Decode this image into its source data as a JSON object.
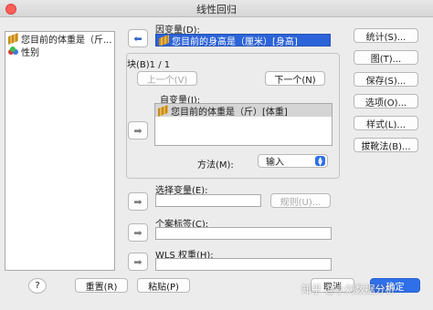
{
  "window": {
    "title": "线性回归"
  },
  "variables": [
    {
      "icon": "ruler-icon",
      "label": "您目前的体重是（斤..."
    },
    {
      "icon": "nominal-icon",
      "label": "性别"
    }
  ],
  "dependent": {
    "label": "因变量(D):",
    "value": "您目前的身高是（厘米）[身高]"
  },
  "block": {
    "label": "块(B)1 / 1",
    "prev_label": "上一个(V)",
    "next_label": "下一个(N)",
    "independent_label": "自变量(I):",
    "independent_items": [
      "您目前的体重是（斤）[体重]"
    ],
    "method_label": "方法(M):",
    "method_value": "输入"
  },
  "selection": {
    "label": "选择变量(E):",
    "rule_label": "规则(U)..."
  },
  "case_labels": {
    "label": "个案标签(C):"
  },
  "wls": {
    "label": "WLS 权重(H):"
  },
  "side_buttons": [
    "统计(S)...",
    "图(T)...",
    "保存(S)...",
    "选项(O)...",
    "样式(L)...",
    "拔靴法(B)..."
  ],
  "footer": {
    "help": "?",
    "reset": "重置(R)",
    "paste": "粘贴(P)",
    "cancel": "取消",
    "ok": "确定"
  },
  "watermark": "知乎 @小刘数据分析",
  "colors": {
    "accent": "#2f6fe8",
    "selection": "#2c63d8"
  }
}
